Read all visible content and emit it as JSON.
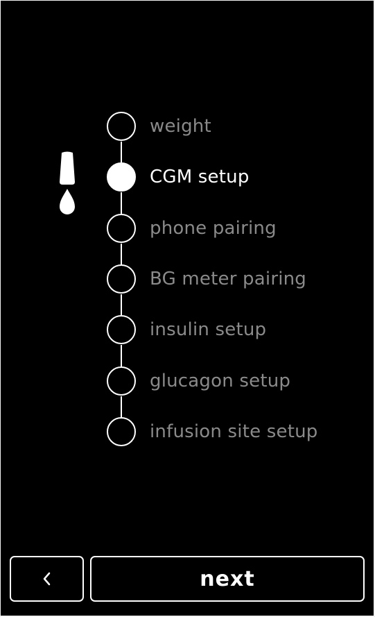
{
  "screen": {
    "icon": "cgm-sensor-drop-icon",
    "steps": [
      {
        "label": "weight",
        "state": "pending"
      },
      {
        "label": "CGM setup",
        "state": "current"
      },
      {
        "label": "phone pairing",
        "state": "pending"
      },
      {
        "label": "BG meter pairing",
        "state": "pending"
      },
      {
        "label": "insulin setup",
        "state": "pending"
      },
      {
        "label": "glucagon setup",
        "state": "pending"
      },
      {
        "label": "infusion site setup",
        "state": "pending"
      }
    ]
  },
  "footer": {
    "back_icon": "chevron-left-icon",
    "next_label": "next"
  },
  "colors": {
    "background": "#000000",
    "active": "#ffffff",
    "inactive_text": "#8a8a8a"
  }
}
